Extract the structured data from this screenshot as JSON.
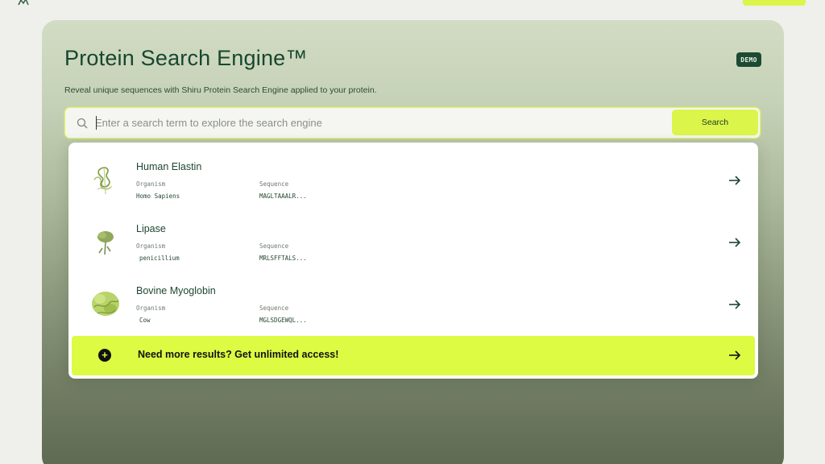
{
  "header": {
    "title": "Protein Search Engine™",
    "demo_badge": "DEMO",
    "subtitle": "Reveal unique sequences with Shiru Protein Search Engine applied to your protein."
  },
  "search": {
    "placeholder": "Enter a search term to explore the search engine",
    "value": "",
    "button_label": "Search"
  },
  "results": [
    {
      "name": "Human Elastin",
      "organism_label": "Organism",
      "organism": "Homo Sapiens",
      "sequence_label": "Sequence",
      "sequence": "MAGLTAAALR..."
    },
    {
      "name": "Lipase",
      "organism_label": "Organism",
      "organism": "penicillium",
      "sequence_label": "Sequence",
      "sequence": "MRLSFFTALS..."
    },
    {
      "name": "Bovine Myoglobin",
      "organism_label": "Organism",
      "organism": "Cow",
      "sequence_label": "Sequence",
      "sequence": "MGLSDGEWQL..."
    }
  ],
  "cta": {
    "text": "Need more results? Get unlimited access!"
  },
  "colors": {
    "accent": "#dcf54a",
    "brand_dark": "#1c4a33",
    "text_green": "#1d4731"
  },
  "icons": {
    "search": "search-icon",
    "arrow": "arrow-right-icon",
    "plus": "plus-circle-icon"
  }
}
